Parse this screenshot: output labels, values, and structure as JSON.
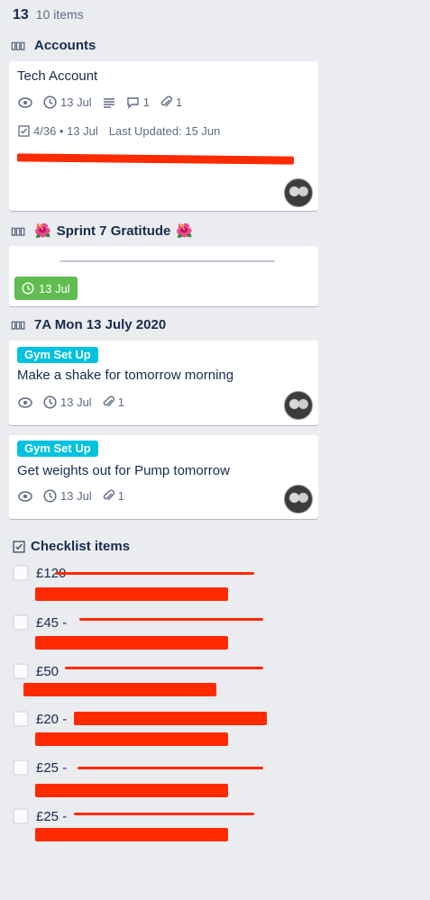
{
  "header": {
    "day": "13",
    "count": "10 items"
  },
  "sections": {
    "accounts": "Accounts",
    "sprint": "Sprint 7 Gratitude",
    "day7a": "7A Mon 13 July 2020",
    "checklist": "Checklist items"
  },
  "cards": [
    {
      "title": "Tech Account",
      "due": "13 Jul",
      "comments": "1",
      "attachments": "1",
      "checklist": "4/36 • 13 Jul",
      "updated": "Last Updated: 15 Jun"
    },
    {
      "due": "13 Jul"
    },
    {
      "label": "Gym Set Up",
      "title": "Make a shake for tomorrow morning",
      "due": "13 Jul",
      "attachments": "1"
    },
    {
      "label": "Gym Set Up",
      "title": "Get weights out for Pump tomorrow",
      "due": "13 Jul",
      "attachments": "1"
    }
  ],
  "checklist_items": [
    {
      "text": "£120"
    },
    {
      "text": "£45 -"
    },
    {
      "text": "£50"
    },
    {
      "text": "£20 -"
    },
    {
      "text": "£25 -"
    },
    {
      "text": "£25 -"
    }
  ],
  "colors": {
    "background": "#ebecf0",
    "label": "#00c2e0",
    "due_complete": "#61bd4f",
    "redaction": "#ff2a00"
  }
}
